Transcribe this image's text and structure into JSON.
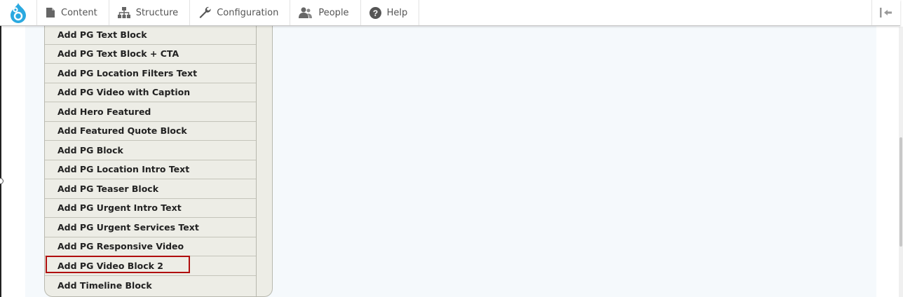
{
  "toolbar": {
    "items": [
      {
        "label": "Content",
        "icon": "file-icon"
      },
      {
        "label": "Structure",
        "icon": "sitemap-icon"
      },
      {
        "label": "Configuration",
        "icon": "wrench-icon"
      },
      {
        "label": "People",
        "icon": "people-icon"
      },
      {
        "label": "Help",
        "icon": "help-icon"
      }
    ],
    "logo_icon": "drupal-logo-icon",
    "orientation_toggle_icon": "orientation-toggle-icon",
    "brand_color": "#2ba9e0"
  },
  "dropdown": {
    "items": [
      "Add PG Text Block",
      "Add PG Text Block + CTA",
      "Add PG Location Filters Text",
      "Add PG Video with Caption",
      "Add Hero Featured",
      "Add Featured Quote Block",
      "Add PG Block",
      "Add PG Location Intro Text",
      "Add PG Teaser Block",
      "Add PG Urgent Intro Text",
      "Add PG Urgent Services Text",
      "Add PG Responsive Video",
      "Add PG Video Block 2",
      "Add Timeline Block"
    ],
    "highlighted_item": "Add PG Video Block 2",
    "highlight_color": "#b00e0e"
  }
}
